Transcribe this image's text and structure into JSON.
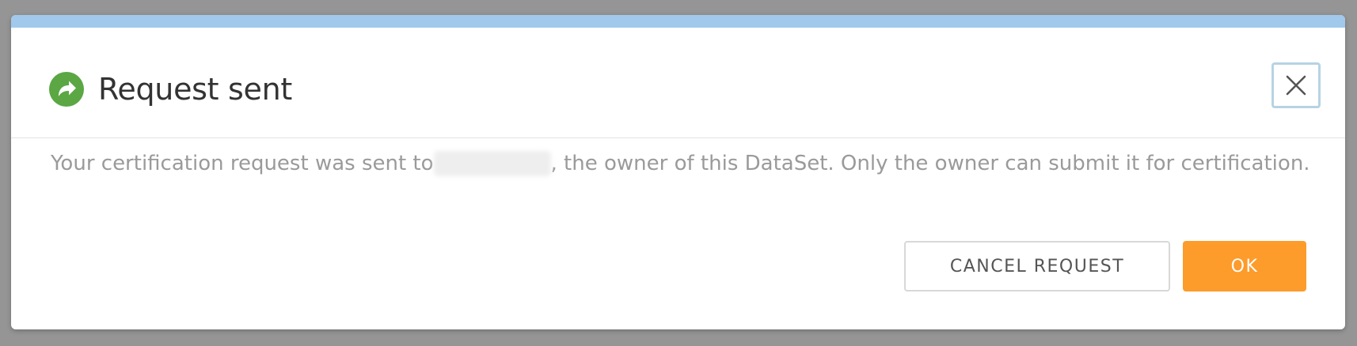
{
  "colors": {
    "accent_bar": "#a1c9ec",
    "success_icon": "#5aa744",
    "primary_button": "#fd9b2b",
    "close_focus_ring": "#b7d3e5"
  },
  "dialog": {
    "title": "Request sent",
    "status_icon": "share-arrow-icon",
    "close_icon": "close-icon",
    "message_before": "Your certification request was sent to",
    "message_after": ", the owner of this DataSet. Only the owner can submit it for certification.",
    "cancel_label": "CANCEL REQUEST",
    "ok_label": "OK"
  }
}
